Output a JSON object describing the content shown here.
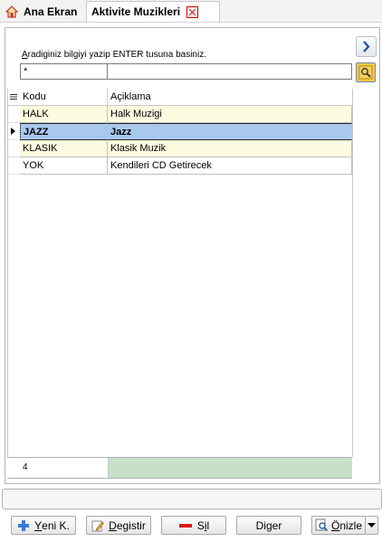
{
  "tabs": {
    "home_label": "Ana Ekran",
    "active_label": "Aktivite Muzikleri"
  },
  "search": {
    "prompt_first_letter": "A",
    "prompt_rest": "radiginiz bilgiyi yazip ENTER tusuna basiniz.",
    "code_value": "*",
    "desc_value": ""
  },
  "grid": {
    "headers": {
      "code": "Kodu",
      "desc": "Açiklama"
    },
    "rows": [
      {
        "code": "HALK",
        "desc": "Halk Muzigi"
      },
      {
        "code": "JAZZ",
        "desc": "Jazz"
      },
      {
        "code": "KLASIK",
        "desc": "Klasik Muzik"
      },
      {
        "code": "YOK",
        "desc": "Kendileri CD Getirecek"
      }
    ],
    "selected_row": "JAZZ",
    "record_count": "4"
  },
  "buttons": {
    "new_ul": "Y",
    "new_rest": "eni K.",
    "edit_ul": "D",
    "edit_rest": "egistir",
    "delete_pre": "S",
    "delete_ul": "i",
    "delete_post": "l",
    "other_pre": "Di",
    "other_ul": "g",
    "other_post": "er",
    "preview_ul": "Ö",
    "preview_rest": "nizle"
  },
  "colors": {
    "selected_row": "#a8c8ee",
    "alt_row": "#fdfbe0",
    "footer_green": "#c7e0c7",
    "close_red": "#dd0000",
    "delete_red": "#d81818",
    "new_blue": "#3a7ad8"
  },
  "icons": {
    "home": "home-icon",
    "close": "close-icon",
    "next": "chevron-right-icon",
    "find": "find-icon",
    "list": "list-icon",
    "row_pointer": "row-pointer-icon",
    "new": "plus-icon",
    "edit": "pencil-icon",
    "delete": "minus-icon",
    "preview": "preview-icon",
    "dropdown": "chevron-down-icon"
  }
}
